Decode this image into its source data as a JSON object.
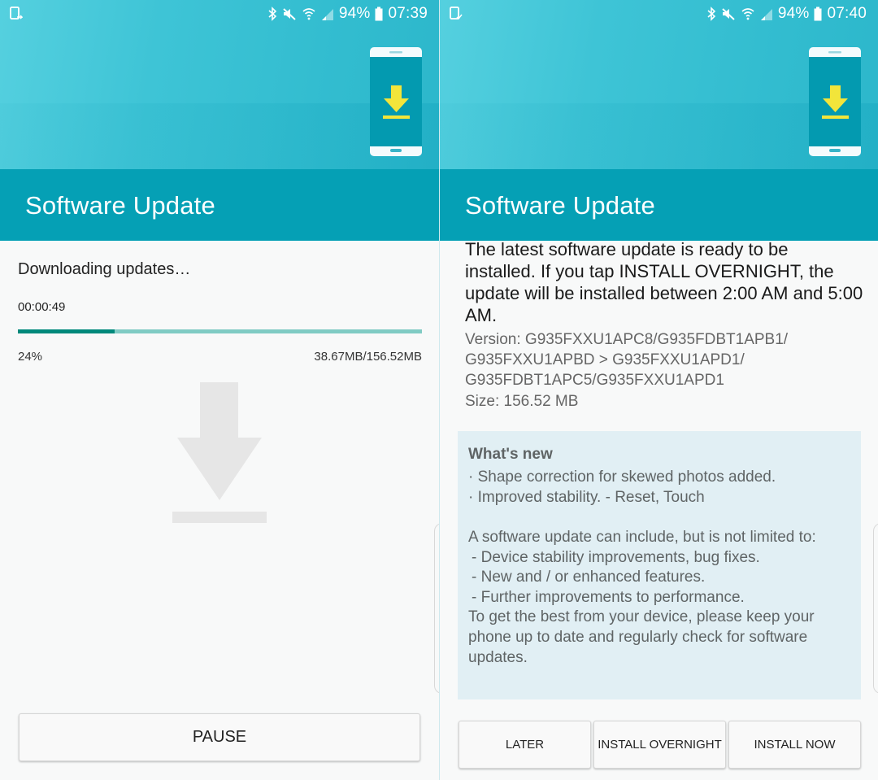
{
  "left_screen": {
    "status_bar": {
      "notification_icon": "screen-mirror-icon",
      "icons": [
        "bluetooth-icon",
        "mute-icon",
        "wifi-icon",
        "signal-icon"
      ],
      "battery_percent": "94%",
      "battery_icon": "battery-icon",
      "time": "07:39"
    },
    "illustration": "phone-download-icon",
    "title": "Software Update",
    "download": {
      "status": "Downloading updates…",
      "elapsed": "00:00:49",
      "progress_percent": 24,
      "percent_label": "24%",
      "size_label": "38.67MB/156.52MB"
    },
    "placeholder_icon": "download-arrow-icon",
    "buttons": {
      "pause": "PAUSE"
    }
  },
  "right_screen": {
    "status_bar": {
      "notification_icon": "screen-mirror-check-icon",
      "icons": [
        "bluetooth-icon",
        "mute-icon",
        "wifi-icon",
        "signal-icon"
      ],
      "battery_percent": "94%",
      "battery_icon": "battery-icon",
      "time": "07:40"
    },
    "illustration": "phone-download-icon",
    "title": "Software Update",
    "info": {
      "message": "The latest software update is ready to be installed. If you tap INSTALL OVERNIGHT, the update will be installed between 2:00 AM and 5:00 AM.",
      "version": "Version: G935FXXU1APC8/G935FDBT1APB1/ G935FXXU1APBD > G935FXXU1APD1/ G935FDBT1APC5/G935FXXU1APD1",
      "size": "Size: 156.52 MB"
    },
    "whats_new": {
      "title": "What's new",
      "items": [
        "· Shape correction for skewed photos added.",
        "· Improved stability. - Reset, Touch"
      ],
      "description_intro": "A software update can include, but is not limited to:",
      "description_items": [
        "- Device stability improvements, bug fixes.",
        "- New and / or enhanced features.",
        "- Further improvements to performance."
      ],
      "description_outro": "To get the best from your device, please keep your phone up to date and regularly check for software updates."
    },
    "buttons": {
      "later": "LATER",
      "install_overnight": "INSTALL OVERNIGHT",
      "install_now": "INSTALL NOW"
    }
  },
  "colors": {
    "title_bar": "#05a0b5",
    "hero": "#3ec4d6",
    "progress_fill": "#00897b",
    "progress_track": "#80cbc4",
    "illustration_arrow": "#f2e53a",
    "whats_new_bg": "#e1eff4"
  }
}
